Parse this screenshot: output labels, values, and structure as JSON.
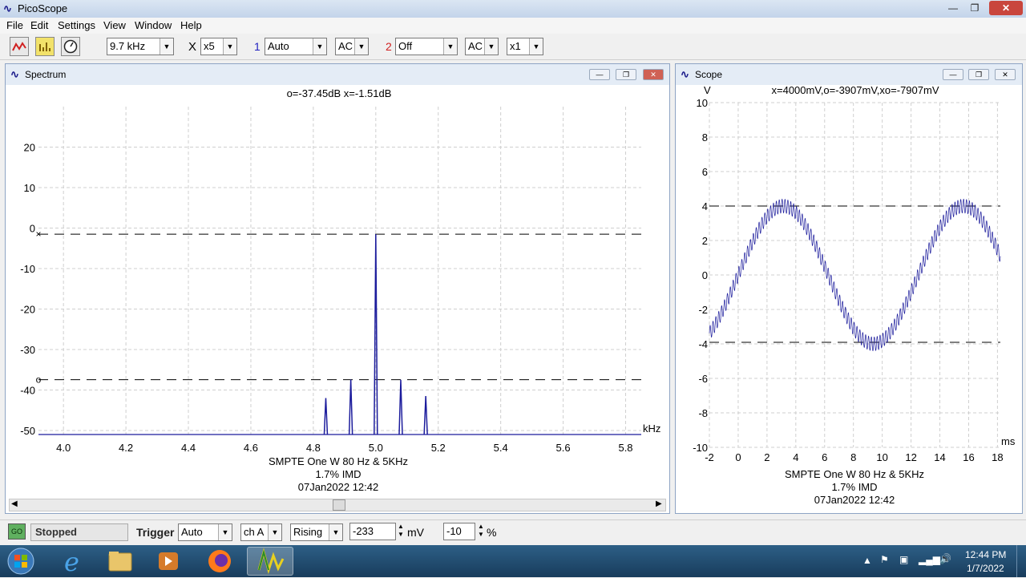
{
  "app": {
    "title": "PicoScope"
  },
  "menu": [
    "File",
    "Edit",
    "Settings",
    "View",
    "Window",
    "Help"
  ],
  "toolbar": {
    "timebase": "9.7 kHz",
    "x_label": "X",
    "x_mult": "x5",
    "ch1_num": "1",
    "ch1_range": "Auto",
    "ch1_coupling": "AC",
    "ch2_num": "2",
    "ch2_range": "Off",
    "ch2_coupling": "AC",
    "ch2_mult": "x1",
    "ch1_color": "#2020c0",
    "ch2_color": "#d02020"
  },
  "spectrum": {
    "title": "Spectrum",
    "readout": "o=-37.45dB  x=-1.51dB",
    "x_unit": "kHz",
    "caption1": "SMPTE One W 80 Hz & 5KHz",
    "caption2": "1.7% IMD",
    "caption3": "07Jan2022  12:42",
    "x_ticks": [
      "4.0",
      "4.2",
      "4.4",
      "4.6",
      "4.8",
      "5.0",
      "5.2",
      "5.4",
      "5.6",
      "5.8"
    ],
    "y_ticks": [
      "20",
      "10",
      "0",
      "-10",
      "-20",
      "-30",
      "-40",
      "-50"
    ],
    "cursor_x_mark": "×",
    "cursor_o_mark": "o",
    "cursor_x_db": -1.51,
    "cursor_o_db": -37.45,
    "trace_color": "#1c1c9c",
    "chart_data": {
      "type": "line",
      "x_range_khz": [
        3.92,
        5.85
      ],
      "y_range_db": [
        -51,
        30
      ],
      "peaks": [
        {
          "f": 4.84,
          "db": -42
        },
        {
          "f": 4.92,
          "db": -37.45
        },
        {
          "f": 5.0,
          "db": -1.51
        },
        {
          "f": 5.08,
          "db": -37.5
        },
        {
          "f": 5.16,
          "db": -41.5
        }
      ]
    }
  },
  "scope": {
    "title": "Scope",
    "readout": "x=4000mV,o=-3907mV,xo=-7907mV",
    "y_unit": "V",
    "x_unit": "ms",
    "caption1": "SMPTE One W 80 Hz & 5KHz",
    "caption2": "1.7% IMD",
    "caption3": "07Jan2022  12:42",
    "x_ticks": [
      "-2",
      "0",
      "2",
      "4",
      "6",
      "8",
      "10",
      "12",
      "14",
      "16",
      "18"
    ],
    "y_ticks": [
      "10",
      "8",
      "6",
      "4",
      "2",
      "0",
      "-2",
      "-4",
      "-6",
      "-8",
      "-10"
    ],
    "cursor_x_v": 4.0,
    "cursor_o_v": -3.907,
    "trace_color": "#1c1c9c",
    "chart_data": {
      "type": "line",
      "x_range_ms": [
        -2,
        18.2
      ],
      "y_range_v": [
        -10,
        10
      ],
      "low_freq_hz": 80,
      "low_amp_v": 4.0,
      "high_freq_hz": 5000,
      "high_amp_v": 0.4
    }
  },
  "status": {
    "go_label": "GO",
    "state": "Stopped",
    "trigger_label": "Trigger",
    "trigger_mode": "Auto",
    "trigger_channel": "ch A",
    "trigger_edge": "Rising",
    "trigger_level": "-233",
    "trigger_level_unit": "mV",
    "pretrigger": "-10",
    "pretrigger_unit": "%"
  },
  "taskbar": {
    "time": "12:44 PM",
    "date": "1/7/2022"
  }
}
